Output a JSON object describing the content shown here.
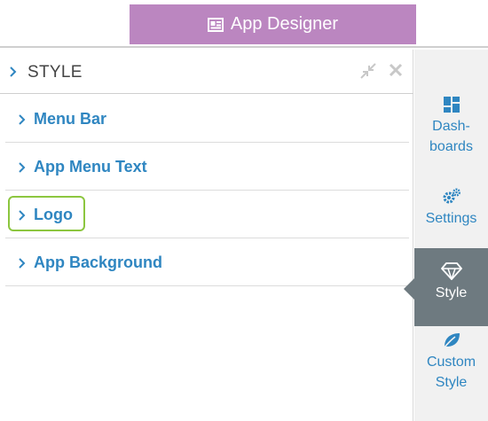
{
  "header": {
    "designer_label": "App Designer",
    "designer_icon": "layout-icon",
    "designer_color": "#bb86c0"
  },
  "panel": {
    "title": "STYLE",
    "collapse_icon": "collapse-arrows-icon",
    "close_icon": "close-icon",
    "sections": [
      {
        "label": "Menu Bar"
      },
      {
        "label": "App Menu Text"
      },
      {
        "label": "Logo",
        "highlighted": true
      },
      {
        "label": "App Background"
      }
    ]
  },
  "sidebar": {
    "items": [
      {
        "label_line1": "Dash-",
        "label_line2": "boards",
        "icon": "dashboard-icon"
      },
      {
        "label_line1": "Settings",
        "label_line2": "",
        "icon": "gears-icon"
      },
      {
        "label_line1": "Style",
        "label_line2": "",
        "icon": "diamond-icon",
        "active": true
      },
      {
        "label_line1": "Custom",
        "label_line2": "Style",
        "icon": "leaf-icon"
      }
    ]
  },
  "colors": {
    "link_blue": "#2f86c1",
    "active_bg": "#6e7a80",
    "highlight_green": "#8cc63f",
    "sidebar_bg": "#f1f1f1"
  }
}
